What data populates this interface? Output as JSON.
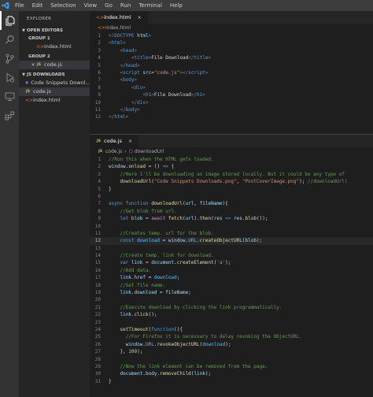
{
  "menu": {
    "items": [
      "File",
      "Edit",
      "Selection",
      "View",
      "Go",
      "Run",
      "Terminal",
      "Help"
    ]
  },
  "activity_bar": {
    "icons": [
      "files-icon",
      "search-icon",
      "source-control-icon",
      "run-debug-icon",
      "remote-explorer-icon",
      "extensions-icon"
    ]
  },
  "sidebar": {
    "title": "EXPLORER",
    "open_editors": {
      "label": "OPEN EDITORS",
      "groups": [
        {
          "label": "GROUP 1",
          "files": [
            {
              "name": "index.html",
              "type": "html"
            }
          ]
        },
        {
          "label": "GROUP 2",
          "files": [
            {
              "name": "code.js",
              "type": "js"
            }
          ]
        }
      ]
    },
    "folder": {
      "label": "JS DOWNLOADS",
      "items": [
        {
          "name": "Code Snippets Downl...",
          "type": "image"
        },
        {
          "name": "code.js",
          "type": "js"
        },
        {
          "name": "index.html",
          "type": "html"
        }
      ]
    }
  },
  "editor_group1": {
    "tab": {
      "label": "index.html",
      "icon": "html-file-icon"
    },
    "breadcrumb": [
      "index.html"
    ],
    "lines": [
      {
        "n": "1",
        "tokens": [
          [
            "punct",
            "<"
          ],
          [
            "tag",
            "!DOCTYPE "
          ],
          [
            "attr",
            "html"
          ],
          [
            "punct",
            ">"
          ]
        ]
      },
      {
        "n": "2",
        "tokens": [
          [
            "punct",
            "<"
          ],
          [
            "tag",
            "html"
          ],
          [
            "punct",
            ">"
          ]
        ]
      },
      {
        "n": "3",
        "tokens": [
          [
            "text",
            "    "
          ],
          [
            "punct",
            "<"
          ],
          [
            "tag",
            "head"
          ],
          [
            "punct",
            ">"
          ]
        ]
      },
      {
        "n": "4",
        "tokens": [
          [
            "text",
            "        "
          ],
          [
            "punct",
            "<"
          ],
          [
            "tag",
            "title"
          ],
          [
            "punct",
            ">"
          ],
          [
            "text",
            "File Download"
          ],
          [
            "punct",
            "</"
          ],
          [
            "tag",
            "title"
          ],
          [
            "punct",
            ">"
          ]
        ]
      },
      {
        "n": "5",
        "tokens": [
          [
            "text",
            "    "
          ],
          [
            "punct",
            "</"
          ],
          [
            "tag",
            "head"
          ],
          [
            "punct",
            ">"
          ]
        ]
      },
      {
        "n": "6",
        "tokens": [
          [
            "text",
            "    "
          ],
          [
            "punct",
            "<"
          ],
          [
            "tag",
            "script "
          ],
          [
            "attr",
            "src"
          ],
          [
            "text",
            "="
          ],
          [
            "str",
            "\"code.js\""
          ],
          [
            "punct",
            "></"
          ],
          [
            "tag",
            "script"
          ],
          [
            "punct",
            ">"
          ]
        ]
      },
      {
        "n": "7",
        "tokens": [
          [
            "text",
            "    "
          ],
          [
            "punct",
            "<"
          ],
          [
            "tag",
            "body"
          ],
          [
            "punct",
            ">"
          ]
        ]
      },
      {
        "n": "8",
        "tokens": [
          [
            "text",
            "        "
          ],
          [
            "punct",
            "<"
          ],
          [
            "tag",
            "div"
          ],
          [
            "punct",
            ">"
          ]
        ]
      },
      {
        "n": "9",
        "tokens": [
          [
            "text",
            "            "
          ],
          [
            "punct",
            "<"
          ],
          [
            "tag",
            "h1"
          ],
          [
            "punct",
            ">"
          ],
          [
            "text",
            "File Download"
          ],
          [
            "punct",
            "</"
          ],
          [
            "tag",
            "h1"
          ],
          [
            "punct",
            ">"
          ]
        ]
      },
      {
        "n": "10",
        "tokens": [
          [
            "text",
            "        "
          ],
          [
            "punct",
            "</"
          ],
          [
            "tag",
            "div"
          ],
          [
            "punct",
            ">"
          ]
        ]
      },
      {
        "n": "11",
        "tokens": [
          [
            "text",
            "    "
          ],
          [
            "punct",
            "</"
          ],
          [
            "tag",
            "body"
          ],
          [
            "punct",
            ">"
          ]
        ]
      },
      {
        "n": "12",
        "tokens": [
          [
            "punct",
            "</"
          ],
          [
            "tag",
            "html"
          ],
          [
            "punct",
            ">"
          ]
        ]
      }
    ]
  },
  "editor_group2": {
    "tab": {
      "label": "code.js",
      "icon": "js-file-icon"
    },
    "breadcrumb": [
      "code.js",
      "downloadUrl"
    ],
    "current_line": "12",
    "lines": [
      {
        "n": "1",
        "tokens": [
          [
            "comment",
            "//Run this when the HTML gets loaded."
          ]
        ]
      },
      {
        "n": "2",
        "tokens": [
          [
            "var",
            "window"
          ],
          [
            "text",
            "."
          ],
          [
            "fn",
            "onload"
          ],
          [
            "text",
            " = () "
          ],
          [
            "kw",
            "=>"
          ],
          [
            "text",
            " {"
          ]
        ]
      },
      {
        "n": "3",
        "tokens": [
          [
            "text",
            "    "
          ],
          [
            "comment",
            "//Here I'll be downloading an image stored locally. But it could be any type of"
          ]
        ]
      },
      {
        "n": "4",
        "tokens": [
          [
            "text",
            "    "
          ],
          [
            "fn",
            "downloadUrl"
          ],
          [
            "text",
            "("
          ],
          [
            "str",
            "\"Code Snippets Downloads.png\""
          ],
          [
            "text",
            ", "
          ],
          [
            "str",
            "\"PostCoverImage.png\""
          ],
          [
            "text",
            "); "
          ],
          [
            "comment",
            "//downloadUrl("
          ]
        ]
      },
      {
        "n": "5",
        "tokens": [
          [
            "text",
            "}"
          ]
        ]
      },
      {
        "n": "6",
        "tokens": [
          [
            "text",
            ""
          ]
        ]
      },
      {
        "n": "7",
        "tokens": [
          [
            "kw",
            "async function "
          ],
          [
            "fn",
            "downloadUrl"
          ],
          [
            "text",
            "("
          ],
          [
            "var",
            "url"
          ],
          [
            "text",
            ", "
          ],
          [
            "var",
            "fileName"
          ],
          [
            "text",
            "){"
          ]
        ]
      },
      {
        "n": "8",
        "tokens": [
          [
            "text",
            "    "
          ],
          [
            "comment",
            "//Get blob from url."
          ]
        ]
      },
      {
        "n": "9",
        "tokens": [
          [
            "text",
            "    "
          ],
          [
            "kw",
            "let "
          ],
          [
            "var",
            "blob"
          ],
          [
            "text",
            " = "
          ],
          [
            "ctrl",
            "await "
          ],
          [
            "fn",
            "fetch"
          ],
          [
            "text",
            "("
          ],
          [
            "var",
            "url"
          ],
          [
            "text",
            ")."
          ],
          [
            "fn",
            "then"
          ],
          [
            "text",
            "("
          ],
          [
            "var",
            "res"
          ],
          [
            "text",
            " "
          ],
          [
            "kw",
            "=>"
          ],
          [
            "text",
            " "
          ],
          [
            "var",
            "res"
          ],
          [
            "text",
            "."
          ],
          [
            "fn",
            "blob"
          ],
          [
            "text",
            "());"
          ]
        ]
      },
      {
        "n": "10",
        "tokens": [
          [
            "text",
            ""
          ]
        ]
      },
      {
        "n": "11",
        "tokens": [
          [
            "text",
            "    "
          ],
          [
            "comment",
            "//Creates temp. url for the blob."
          ]
        ]
      },
      {
        "n": "12",
        "tokens": [
          [
            "text",
            "    "
          ],
          [
            "kw",
            "const "
          ],
          [
            "const",
            "download"
          ],
          [
            "text",
            " = "
          ],
          [
            "var",
            "window"
          ],
          [
            "text",
            "."
          ],
          [
            "const",
            "URL"
          ],
          [
            "text",
            "."
          ],
          [
            "fn",
            "createObjectURL"
          ],
          [
            "text",
            "("
          ],
          [
            "var",
            "blob"
          ],
          [
            "text",
            ");"
          ]
        ]
      },
      {
        "n": "13",
        "tokens": [
          [
            "text",
            ""
          ]
        ]
      },
      {
        "n": "14",
        "tokens": [
          [
            "text",
            "    "
          ],
          [
            "comment",
            "//Create temp. link for download."
          ]
        ]
      },
      {
        "n": "15",
        "tokens": [
          [
            "text",
            "    "
          ],
          [
            "kw",
            "var "
          ],
          [
            "var",
            "link"
          ],
          [
            "text",
            " = "
          ],
          [
            "var",
            "document"
          ],
          [
            "text",
            "."
          ],
          [
            "fn",
            "createElement"
          ],
          [
            "text",
            "("
          ],
          [
            "str",
            "'a'"
          ],
          [
            "text",
            ");"
          ]
        ]
      },
      {
        "n": "16",
        "tokens": [
          [
            "text",
            "    "
          ],
          [
            "comment",
            "//Add data."
          ]
        ]
      },
      {
        "n": "17",
        "tokens": [
          [
            "text",
            "    "
          ],
          [
            "var",
            "link"
          ],
          [
            "text",
            "."
          ],
          [
            "prop",
            "href"
          ],
          [
            "text",
            " = "
          ],
          [
            "const",
            "download"
          ],
          [
            "text",
            ";"
          ]
        ]
      },
      {
        "n": "18",
        "tokens": [
          [
            "text",
            "    "
          ],
          [
            "comment",
            "//Set file name."
          ]
        ]
      },
      {
        "n": "19",
        "tokens": [
          [
            "text",
            "    "
          ],
          [
            "var",
            "link"
          ],
          [
            "text",
            "."
          ],
          [
            "prop",
            "download"
          ],
          [
            "text",
            " = "
          ],
          [
            "var",
            "fileName"
          ],
          [
            "text",
            ";"
          ]
        ]
      },
      {
        "n": "20",
        "tokens": [
          [
            "text",
            ""
          ]
        ]
      },
      {
        "n": "21",
        "tokens": [
          [
            "text",
            "    "
          ],
          [
            "comment",
            "//Execute download by clicking the link programmatically."
          ]
        ]
      },
      {
        "n": "22",
        "tokens": [
          [
            "text",
            "    "
          ],
          [
            "var",
            "link"
          ],
          [
            "text",
            "."
          ],
          [
            "fn",
            "click"
          ],
          [
            "text",
            "();"
          ]
        ]
      },
      {
        "n": "23",
        "tokens": [
          [
            "text",
            ""
          ]
        ]
      },
      {
        "n": "24",
        "tokens": [
          [
            "text",
            "    "
          ],
          [
            "fn",
            "setTimeout"
          ],
          [
            "text",
            "("
          ],
          [
            "kw",
            "function"
          ],
          [
            "text",
            "(){"
          ]
        ]
      },
      {
        "n": "25",
        "tokens": [
          [
            "text",
            "      "
          ],
          [
            "comment",
            "//For Firefox it is necessary to delay revoking the ObjectURL."
          ]
        ]
      },
      {
        "n": "26",
        "tokens": [
          [
            "text",
            "      "
          ],
          [
            "var",
            "window"
          ],
          [
            "text",
            "."
          ],
          [
            "const",
            "URL"
          ],
          [
            "text",
            "."
          ],
          [
            "fn",
            "revokeObjectURL"
          ],
          [
            "text",
            "("
          ],
          [
            "const",
            "download"
          ],
          [
            "text",
            ");"
          ]
        ]
      },
      {
        "n": "27",
        "tokens": [
          [
            "text",
            "    }, "
          ],
          [
            "num",
            "100"
          ],
          [
            "text",
            ");"
          ]
        ]
      },
      {
        "n": "28",
        "tokens": [
          [
            "text",
            ""
          ]
        ]
      },
      {
        "n": "29",
        "tokens": [
          [
            "text",
            "    "
          ],
          [
            "comment",
            "//Now the link element can be removed from the page."
          ]
        ]
      },
      {
        "n": "30",
        "tokens": [
          [
            "text",
            "    "
          ],
          [
            "var",
            "document"
          ],
          [
            "text",
            "."
          ],
          [
            "prop",
            "body"
          ],
          [
            "text",
            "."
          ],
          [
            "fn",
            "removeChild"
          ],
          [
            "text",
            "("
          ],
          [
            "var",
            "link"
          ],
          [
            "text",
            ");"
          ]
        ]
      },
      {
        "n": "31",
        "tokens": [
          [
            "text",
            "}"
          ]
        ]
      }
    ]
  },
  "colors": {
    "accent": "#007acc",
    "editor_bg": "#1e1e1e",
    "sidebar_bg": "#252526",
    "activity_bg": "#333333"
  }
}
